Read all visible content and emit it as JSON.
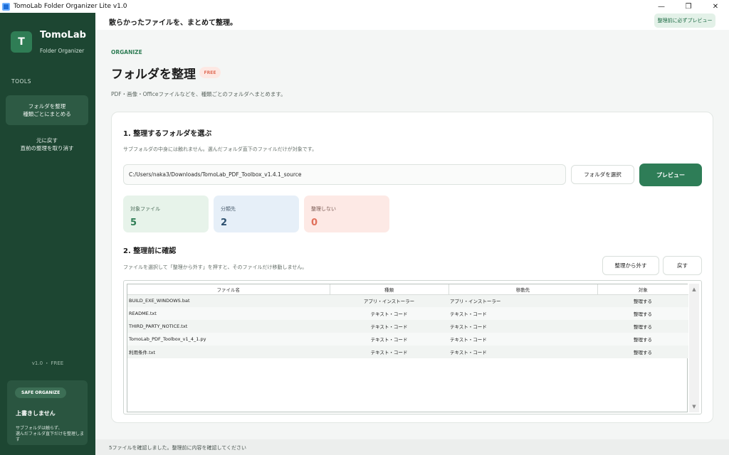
{
  "window": {
    "title": "TomoLab Folder Organizer Lite v1.0",
    "controls": {
      "minimize": "—",
      "restore": "❐",
      "close": "✕"
    }
  },
  "sidebar": {
    "logo_letter": "T",
    "brand_name": "TomoLab",
    "brand_sub": "Folder Organizer",
    "section_label": "TOOLS",
    "items": [
      {
        "line1": "フォルダを整理",
        "line2": "種類ごとにまとめる",
        "active": true
      },
      {
        "line1": "元に戻す",
        "line2": "直前の整理を取り消す",
        "active": false
      }
    ],
    "version": "v1.0 ・ FREE",
    "safe_card": {
      "pill": "SAFE ORGANIZE",
      "title": "上書きしません",
      "desc_line1": "サブフォルダは触らず、",
      "desc_line2": "選んだフォルダ直下だけを整理します"
    }
  },
  "header": {
    "title": "散らかったファイルを、まとめて整理。",
    "preview_hint": "整理前に必ずプレビュー"
  },
  "main": {
    "eyebrow": "ORGANIZE",
    "title": "フォルダを整理",
    "badge": "FREE",
    "description": "PDF・画像・Officeファイルなどを、種類ごとのフォルダへまとめます。",
    "step1": {
      "title": "1. 整理するフォルダを選ぶ",
      "desc": "サブフォルダの中身には触れません。選んだフォルダ直下のファイルだけが対象です。",
      "path": "C:/Users/naka3/Downloads/TomoLab_PDF_Toolbox_v1.4.1_source",
      "select_button": "フォルダを選択",
      "preview_button": "プレビュー"
    },
    "stats": [
      {
        "label": "対象ファイル",
        "value": "5"
      },
      {
        "label": "分類先",
        "value": "2"
      },
      {
        "label": "整理しない",
        "value": "0"
      }
    ],
    "step2": {
      "title": "2. 整理前に確認",
      "desc": "ファイルを選択して「整理から外す」を押すと、そのファイルだけ移動しません。",
      "exclude_button": "整理から外す",
      "restore_button": "戻す",
      "columns": [
        "ファイル名",
        "種類",
        "移動先",
        "対象"
      ],
      "rows": [
        {
          "name": "BUILD_EXE_WINDOWS.bat",
          "kind": "アプリ・インストーラー",
          "dest": "アプリ・インストーラー",
          "target": "整理する"
        },
        {
          "name": "README.txt",
          "kind": "テキスト・コード",
          "dest": "テキスト・コード",
          "target": "整理する"
        },
        {
          "name": "THIRD_PARTY_NOTICE.txt",
          "kind": "テキスト・コード",
          "dest": "テキスト・コード",
          "target": "整理する"
        },
        {
          "name": "TomoLab_PDF_Toolbox_v1_4_1.py",
          "kind": "テキスト・コード",
          "dest": "テキスト・コード",
          "target": "整理する"
        },
        {
          "name": "利用条件.txt",
          "kind": "テキスト・コード",
          "dest": "テキスト・コード",
          "target": "整理する"
        }
      ]
    }
  },
  "statusbar": {
    "text": "5ファイルを確認しました。整理前に内容を確認してください"
  },
  "colors": {
    "sidebar_bg": "#1d4632",
    "accent": "#2e7d57",
    "stat_green_bg": "#e7f3ea",
    "stat_blue_bg": "#e6eff8",
    "stat_red_bg": "#fde9e5"
  }
}
